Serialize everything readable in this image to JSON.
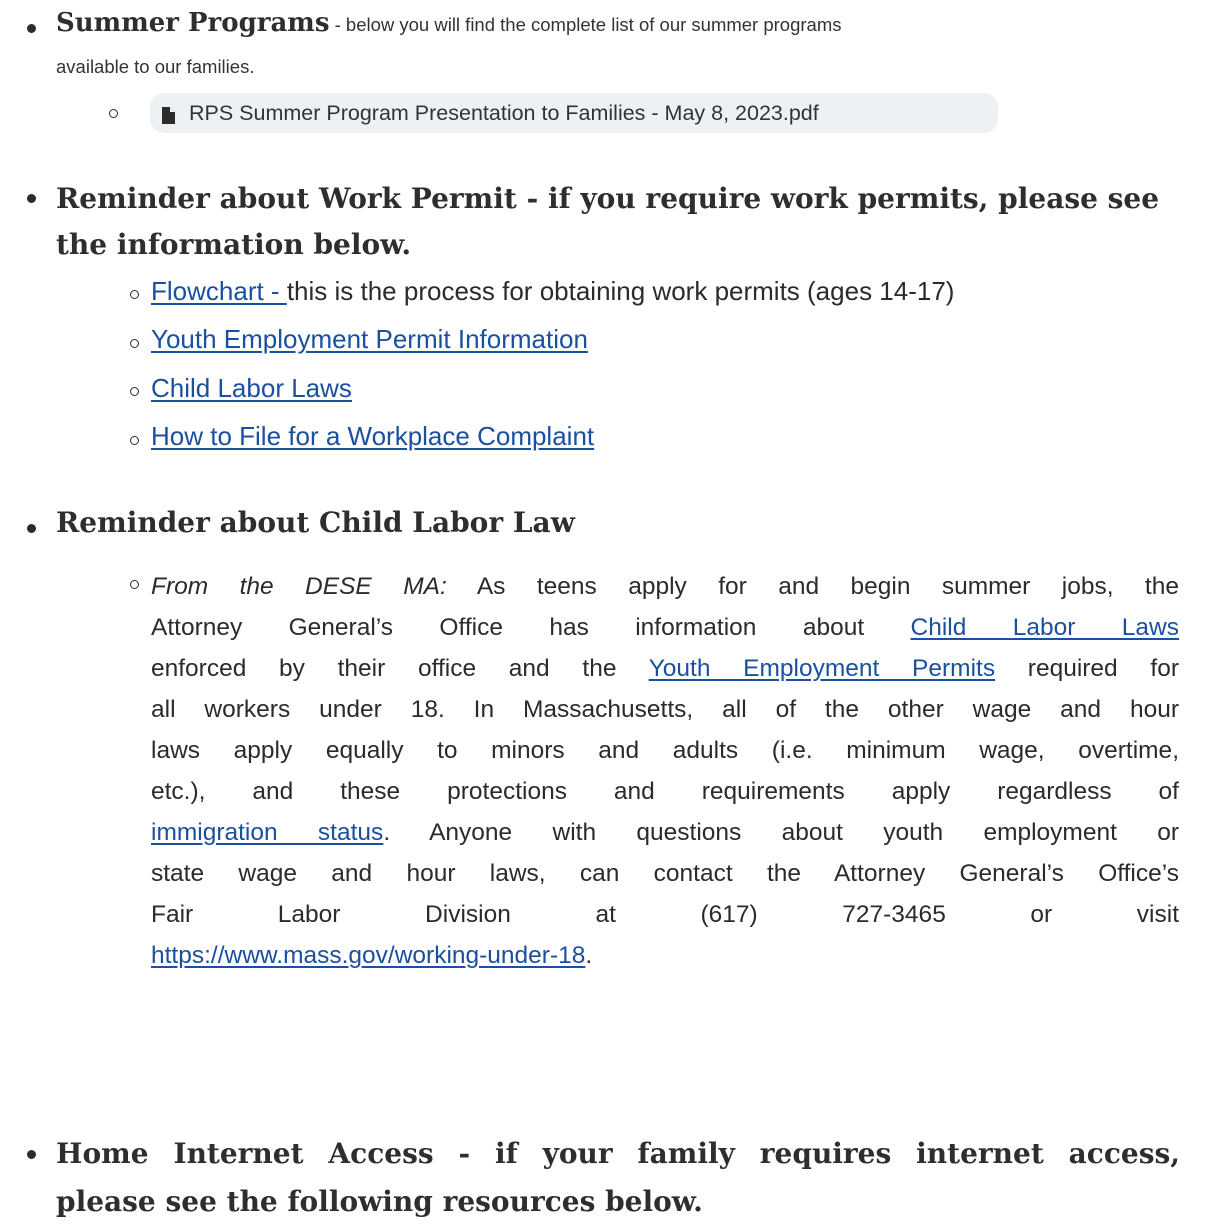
{
  "summer": {
    "heading": "Summer Programs",
    "desc_line1": " - below you will find the complete list of our summer programs",
    "desc_line2": "available to our families.",
    "file_chip_label": "RPS Summer Program Presentation to Families - May 8, 2023.pdf",
    "file_icon": "file-icon"
  },
  "work_permit": {
    "heading_line1": "Reminder about Work Permit - if you require work permits, please see",
    "heading_line2": "the information below.",
    "items": [
      {
        "link": "Flowchart - ",
        "text": " this is the process for obtaining work permits (ages 14-17)"
      },
      {
        "link": "Youth Employment Permit Information",
        "text": ""
      },
      {
        "link": "Child Labor Laws",
        "text": ""
      },
      {
        "link": "How to File for a Workplace Complaint",
        "text": ""
      }
    ]
  },
  "child_labor": {
    "heading": "Reminder about Child Labor Law",
    "source_italic": "From the DESE MA:",
    "l1": " As teens apply for and begin summer jobs, the",
    "l2a": "Attorney General’s Office has information about ",
    "l2_link": "Child Labor Laws",
    "l3a": "enforced by their office and the ",
    "l3_link": "Youth Employment Permits",
    "l3b": " required for",
    "l4": "all workers under 18.  In Massachusetts, all of the other wage and hour",
    "l5": "laws apply equally to minors and adults (i.e. minimum wage, overtime,",
    "l6": "etc.), and these protections and requirements apply regardless of",
    "l7_link": "immigration status",
    "l7b": ". Anyone with questions about youth employment or",
    "l8": "state wage and hour laws, can contact the Attorney General’s Office’s",
    "l9": "Fair Labor Division at (617) 727-3465 or visit",
    "l10_link": "https://www.mass.gov/working-under-18",
    "l10b": "."
  },
  "internet": {
    "heading_line1": "Home Internet Access - if your family requires internet access,",
    "heading_line2": "please see the following resources below."
  }
}
